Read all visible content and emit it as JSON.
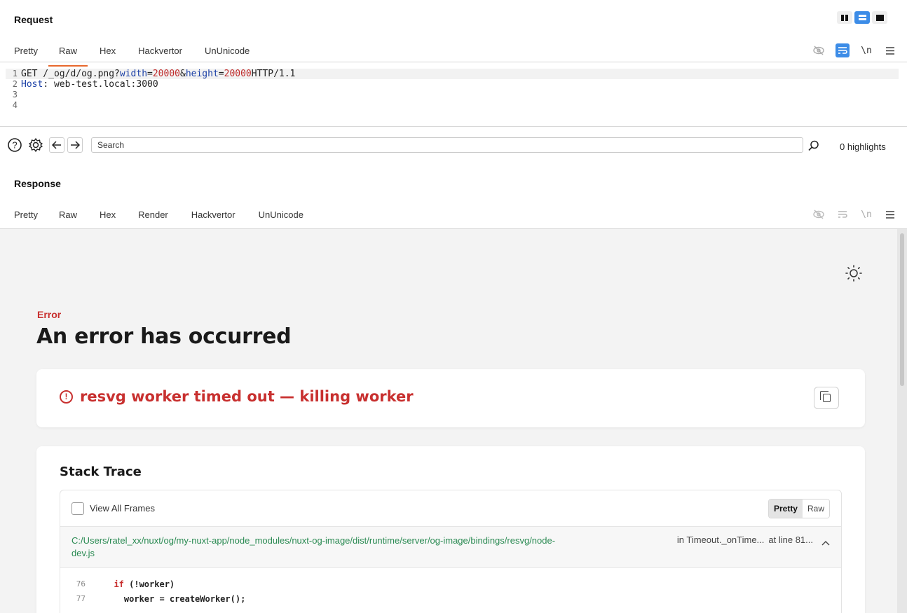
{
  "request": {
    "title": "Request",
    "tabs": [
      {
        "label": "Pretty"
      },
      {
        "label": "Raw"
      },
      {
        "label": "Hex"
      },
      {
        "label": "Hackvertor"
      },
      {
        "label": "UnUnicode"
      }
    ],
    "active_tab": "Raw",
    "newline_label": "\\n",
    "lines": [
      {
        "num": "1",
        "method": "GET /_og/d/og.png?",
        "p1k": "width",
        "eq": "=",
        "p1v": "20000",
        "amp": "&",
        "p2k": "height",
        "p2v": "20000",
        "tail": " HTTP/1.1"
      },
      {
        "num": "2",
        "hkey": "Host",
        "hsep": ": ",
        "hval": "web-test.local:3000"
      },
      {
        "num": "3"
      },
      {
        "num": "4"
      }
    ]
  },
  "search": {
    "placeholder": "Search",
    "highlights": "0 highlights"
  },
  "response": {
    "title": "Response",
    "tabs": [
      {
        "label": "Pretty"
      },
      {
        "label": "Raw"
      },
      {
        "label": "Hex"
      },
      {
        "label": "Render"
      },
      {
        "label": "Hackvertor"
      },
      {
        "label": "UnUnicode"
      }
    ],
    "active_tab": "Render",
    "newline_label": "\\n"
  },
  "render": {
    "error_label": "Error",
    "error_title": "An error has occurred",
    "error_icon": "!",
    "error_message": "resvg worker timed out — killing worker",
    "stack_title": "Stack Trace",
    "view_all_frames": "View All Frames",
    "view_modes": [
      "Pretty",
      "Raw"
    ],
    "frame": {
      "path": "C:/Users/ratel_xx/nuxt/og/my-nuxt-app/node_modules/nuxt-og-image/dist/runtime/server/og-image/bindings/resvg/node-dev.js",
      "location": "in Timeout._onTime...",
      "line": "at line 81..."
    },
    "code": [
      {
        "n": "76",
        "indent": "  ",
        "kw": "if",
        "rest": " (!worker)"
      },
      {
        "n": "77",
        "indent": "    ",
        "kw": "",
        "rest": "worker = createWorker();"
      }
    ]
  },
  "colors": {
    "accent_orange": "#e8682c",
    "accent_blue": "#3c8ce7",
    "error_red": "#c8302f",
    "path_green": "#2a8a52"
  }
}
